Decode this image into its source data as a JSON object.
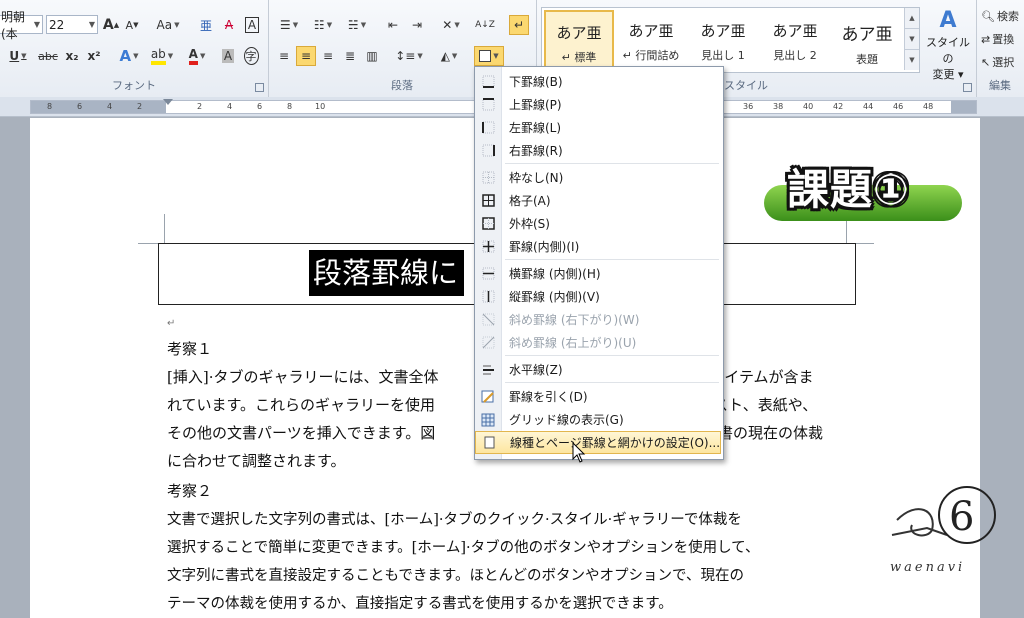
{
  "ribbon": {
    "font": {
      "font_name": "明朝 (本",
      "font_size": "22",
      "grow": "A",
      "shrink": "A",
      "case": "Aa",
      "phonetic": "亜",
      "clear": "A",
      "border_char": "A",
      "underline": "U",
      "strike": "abc",
      "sub": "x₂",
      "sup": "x²",
      "effect": "A",
      "highlight": "ab",
      "color": "A",
      "shade": "A",
      "enclose": "字",
      "label": "フォント"
    },
    "paragraph": {
      "label": "段落",
      "sort": "A↓Z",
      "show_marks": "↵"
    },
    "styles": {
      "label": "スタイル",
      "items": [
        {
          "preview": "あア亜",
          "name": "↵ 標準"
        },
        {
          "preview": "あア亜",
          "name": "↵ 行間詰め"
        },
        {
          "preview": "あア亜",
          "name": "見出し 1"
        },
        {
          "preview": "あア亜",
          "name": "見出し 2"
        },
        {
          "preview": "あア亜",
          "name": "表題"
        }
      ],
      "change_label_1": "スタイルの",
      "change_label_2": "変更 ▾"
    },
    "editing": {
      "label": "編集",
      "find": "検索",
      "replace": "置換",
      "select": "選択"
    }
  },
  "ruler": {
    "numbers_left": [
      "8",
      "6",
      "4",
      "2"
    ],
    "numbers_mid": [
      "2",
      "4",
      "6",
      "8",
      "10"
    ],
    "numbers_right": [
      "36",
      "38",
      "40",
      "42",
      "44",
      "46",
      "48"
    ]
  },
  "document": {
    "title_visible": "段落罫線に",
    "badge": "課題①",
    "lines": [
      "考察１",
      "[挿入]·タブのギャラリーには、文書全体",
      "れています。これらのギャラリーを使用",
      "その他の文書パーツを挿入できます。図",
      "に合わせて調整されます。",
      "考察２",
      "文書で選択した文字列の書式は、[ホーム]·タブのクイック·スタイル·ギャラリーで体裁を",
      "選択することで簡単に変更できます。[ホーム]·タブの他のボタンやオプションを使用して、",
      "文字列に書式を直接設定することもできます。ほとんどのボタンやオプションで、現在の",
      "テーマの体裁を使用するか、直接指定する書式を使用するかを選択できます。"
    ],
    "lines_right": [
      "のアイテムが含ま",
      "リスト、表紙や、",
      "書の現在の体裁"
    ],
    "watermark_text": "waenavi"
  },
  "border_menu": {
    "items": [
      {
        "label": "下罫線(B)",
        "icon": "bottom-border-icon"
      },
      {
        "label": "上罫線(P)",
        "icon": "top-border-icon"
      },
      {
        "label": "左罫線(L)",
        "icon": "left-border-icon"
      },
      {
        "label": "右罫線(R)",
        "icon": "right-border-icon"
      },
      {
        "label": "枠なし(N)",
        "icon": "no-border-icon"
      },
      {
        "label": "格子(A)",
        "icon": "all-borders-icon"
      },
      {
        "label": "外枠(S)",
        "icon": "outside-borders-icon"
      },
      {
        "label": "罫線(内側)(I)",
        "icon": "inside-borders-icon"
      },
      {
        "label": "横罫線 (内側)(H)",
        "icon": "inside-horizontal-border-icon"
      },
      {
        "label": "縦罫線 (内側)(V)",
        "icon": "inside-vertical-border-icon"
      },
      {
        "label": "斜め罫線 (右下がり)(W)",
        "icon": "diagonal-down-border-icon"
      },
      {
        "label": "斜め罫線 (右上がり)(U)",
        "icon": "diagonal-up-border-icon"
      },
      {
        "label": "水平線(Z)",
        "icon": "horizontal-line-icon"
      },
      {
        "label": "罫線を引く(D)",
        "icon": "draw-table-icon"
      },
      {
        "label": "グリッド線の表示(G)",
        "icon": "view-gridlines-icon"
      },
      {
        "label": "線種とページ罫線と網かけの設定(O)...",
        "icon": "borders-and-shading-icon"
      }
    ]
  }
}
